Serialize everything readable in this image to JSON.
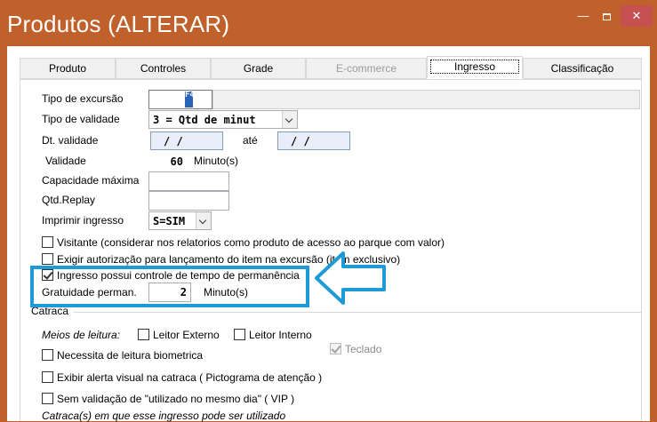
{
  "window": {
    "title": "Produtos (ALTERAR)",
    "minimize_glyph": "—",
    "close_glyph": "✕"
  },
  "tabs": [
    {
      "label": "Produto",
      "state": "normal"
    },
    {
      "label": "Controles",
      "state": "normal"
    },
    {
      "label": "Grade",
      "state": "normal"
    },
    {
      "label": "E-commerce",
      "state": "disabled"
    },
    {
      "label": "Ingresso",
      "state": "active"
    },
    {
      "label": "Classificação",
      "state": "normal"
    }
  ],
  "form": {
    "tipo_excursao": {
      "label": "Tipo de excursão",
      "value": "",
      "f4_key": "F4"
    },
    "tipo_validade": {
      "label": "Tipo de validade",
      "value": "3 = Qtd de minut"
    },
    "dt_validade": {
      "label": "Dt. validade",
      "from": " /  /",
      "ate_label": "até",
      "to": " /  /"
    },
    "validade": {
      "label": "Validade",
      "value": "60",
      "unit": "Minuto(s)"
    },
    "capacidade": {
      "label": "Capacidade máxima",
      "value": ""
    },
    "qtd_replay": {
      "label": "Qtd.Replay",
      "value": ""
    },
    "imprimir": {
      "label": "Imprimir ingresso",
      "value": "S=SIM"
    }
  },
  "checks": {
    "visitante": {
      "label": "Visitante (considerar nos relatorios como produto de acesso ao parque com valor)",
      "checked": false
    },
    "exigir": {
      "label": "Exigir autorização para lançamento do item  na excursão (item exclusivo)",
      "checked": false
    },
    "controle_tempo": {
      "label": "Ingresso possui controle de tempo de permanência",
      "checked": true
    }
  },
  "gratuidade": {
    "label": "Gratuidade perman.",
    "value": "2",
    "unit": "Minuto(s)"
  },
  "catraca": {
    "section_title": "Catraca",
    "meios_label": "Meios de leitura:",
    "leitor_externo": {
      "label": "Leitor Externo",
      "checked": false
    },
    "leitor_interno": {
      "label": "Leitor Interno",
      "checked": false
    },
    "teclado": {
      "label": "Teclado",
      "checked": true,
      "disabled": true
    },
    "biometrica": {
      "label": "Necessita de leitura biometrica",
      "checked": false
    },
    "alerta": {
      "label": "Exibir alerta visual na catraca ( Pictograma de atenção )",
      "checked": false
    },
    "sem_validacao": {
      "label": "Sem validação de \"utilizado no mesmo dia\" ( VIP )",
      "checked": false
    },
    "footer_label": "Catraca(s) em que esse ingresso pode ser utilizado"
  },
  "colors": {
    "titlebar": "#c0602a",
    "highlight": "#1e9ad6",
    "f4_button": "#2a63b8"
  }
}
